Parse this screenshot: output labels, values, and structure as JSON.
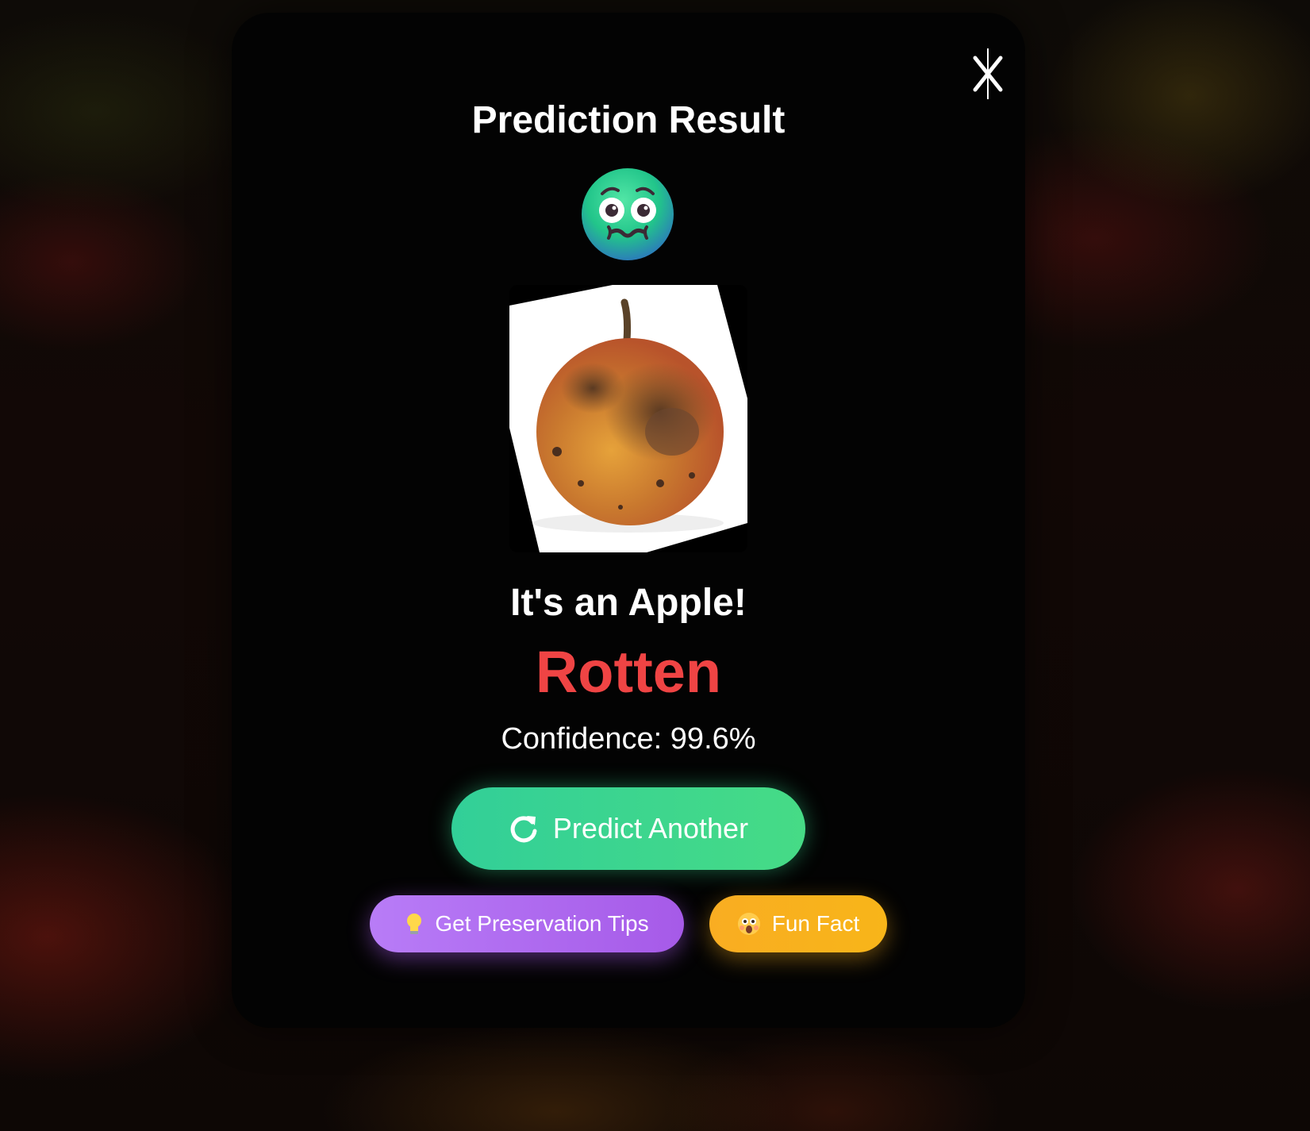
{
  "modal": {
    "title": "Prediction Result",
    "emoji_icon": "nauseated-face-icon",
    "image_alt": "apple-photo",
    "fruit_label": "It's an Apple!",
    "status": "Rotten",
    "status_color": "#ef4444",
    "confidence": "Confidence: 99.6%",
    "close_icon": "close-icon"
  },
  "actions": {
    "predict_another": "Predict Another",
    "predict_icon": "refresh-icon",
    "preservation_tips": "Get Preservation Tips",
    "tips_icon": "lightbulb-icon",
    "fun_fact": "Fun Fact",
    "fact_icon": "astonished-face-icon"
  },
  "colors": {
    "predict_button": "#3ad691",
    "tips_button": "#b070f0",
    "fact_button": "#f9b01f",
    "modal_background": "#030303"
  }
}
